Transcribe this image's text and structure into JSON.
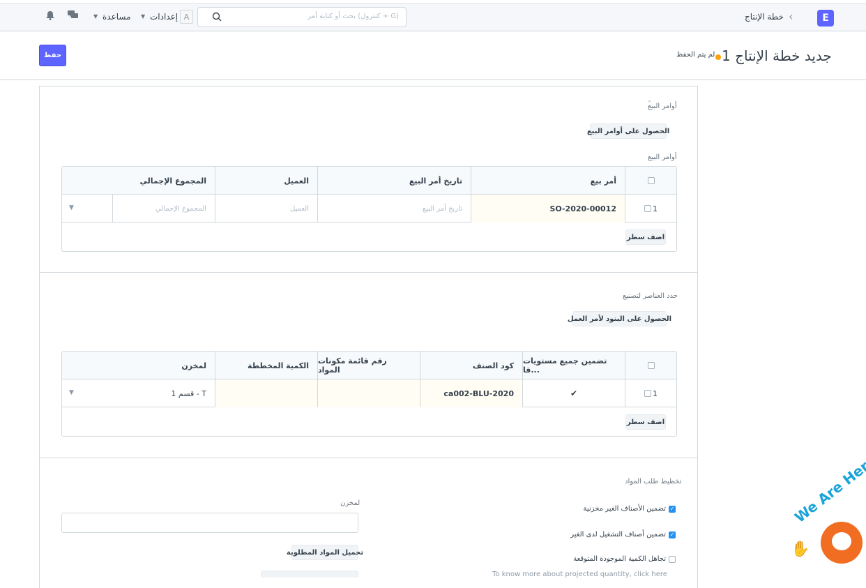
{
  "navbar": {
    "logo": "E",
    "breadcrumb": "خطة الإنتاج",
    "search_placeholder": "بحث أو كتابة أمر (كنترول + G)",
    "avatar_letter": "A",
    "settings_label": "إعدادات",
    "help_label": "مساعدة"
  },
  "header": {
    "title": "جديد خطة الإنتاج 1",
    "status": "لم يتم الحفظ",
    "save_label": "حفظ"
  },
  "sales_section": {
    "section_title": "أوامر البيع",
    "get_button": "الحصول على أوامر البيع",
    "table_label": "أوامر البيع",
    "columns": [
      "أمر بيع",
      "تاريخ أمر البيع",
      "العميل",
      "المجموع الإجمالي"
    ],
    "row": {
      "index": "1",
      "sales_order": "SO-2020-00012",
      "date_placeholder": "تاريخ أمر البيع",
      "customer_placeholder": "العميل",
      "total_placeholder": "المجموع الإجمالي"
    },
    "add_row": "اضف سطر"
  },
  "items_section": {
    "section_title": "حدد العناصر لتصنيع",
    "get_button": "الحصول على البنود لأمر العمل",
    "columns": [
      "تضمين جميع مستويات قا...",
      "كود الصنف",
      "رقم قائمة مكونات المواد",
      "الكمية المخططة",
      "لمخزن"
    ],
    "row": {
      "index": "1",
      "include_check": "✔",
      "item_code": "ca002-BLU-2020",
      "bom": "",
      "planned_qty": "",
      "warehouse": "قسم 1 - T"
    },
    "add_row": "اضف سطر"
  },
  "material_section": {
    "section_title": "تخطيط طلب المواد",
    "warehouse_label": "لمخزن",
    "download_button": "تحميل المواد المطلوبة",
    "checkboxes": [
      {
        "label": "تضمين الأصناف الغير مخزنية",
        "checked": true
      },
      {
        "label": "تضمين أصناف التشغيل لدى الغير",
        "checked": true
      },
      {
        "label": "تجاهل الكمية الموجودة المتوقعة",
        "checked": false
      }
    ],
    "projected_note": "To know more about projected quantity, click here"
  },
  "widget": {
    "text": "We Are Here!"
  }
}
